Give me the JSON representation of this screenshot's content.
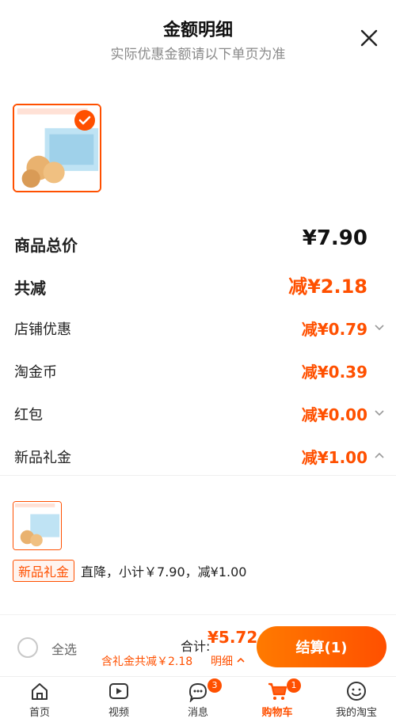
{
  "header": {
    "title": "金额明细",
    "subtitle": "实际优惠金额请以下单页为准",
    "close_icon": "close-icon"
  },
  "product": {
    "thumb_icon": "product-image",
    "selected": true
  },
  "breakdown": {
    "total_label": "商品总价",
    "total_value": "¥7.90",
    "minus_label": "共减",
    "minus_value": "减¥2.18",
    "items": [
      {
        "label": "店铺优惠",
        "value": "减¥0.79",
        "chevron": "chevron-down-icon"
      },
      {
        "label": "淘金币",
        "value": "减¥0.39"
      },
      {
        "label": "红包",
        "value": "减¥0.00",
        "chevron": "chevron-down-icon"
      },
      {
        "label": "新品礼金",
        "value": "减¥1.00",
        "chevron": "chevron-up-icon"
      }
    ]
  },
  "gift": {
    "tag": "新品礼金",
    "text": "直降，小计￥7.90，减¥1.00"
  },
  "bottom": {
    "select_all": "全选",
    "total_label": "合计:",
    "total_value": "¥5.72",
    "included": "含礼金共减￥2.18",
    "detail": "明细",
    "checkout": "结算(1)"
  },
  "tabs": [
    {
      "label": "首页",
      "icon": "home-icon"
    },
    {
      "label": "视频",
      "icon": "video-icon"
    },
    {
      "label": "消息",
      "icon": "message-icon",
      "badge": "3"
    },
    {
      "label": "购物车",
      "icon": "cart-icon",
      "badge": "1"
    },
    {
      "label": "我的淘宝",
      "icon": "profile-icon"
    }
  ],
  "colors": {
    "accent": "#ff5000"
  }
}
